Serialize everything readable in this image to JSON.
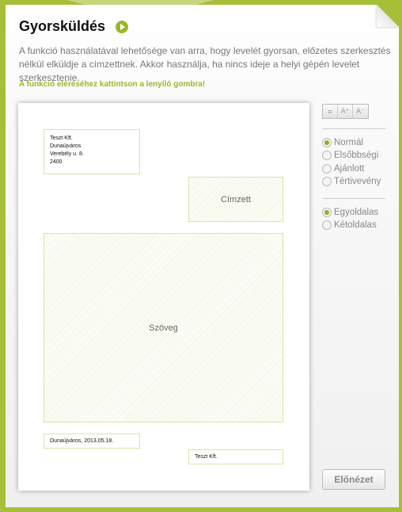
{
  "header": {
    "title": "Gyorsküldés",
    "description": "A funkció használatával lehetősége van arra, hogy levelét gyorsan, előzetes szerkesztés nélkül elküldje a címzettnek. Akkor használja, ha nincs ideje a helyi gépén levelet szerkesztenie.",
    "hint": "A funkció eléréséhez kattintson a lenyíló gombra!"
  },
  "letter": {
    "sender": [
      "Teszt Kft.",
      "Dunaújváros",
      "Verebély u. 8.",
      "2400"
    ],
    "recipient_label": "Címzett",
    "body_label": "Szöveg",
    "date": "Dunaújváros, 2013.05.18.",
    "signature": "Teszt Kft."
  },
  "toolbar": {
    "align": "≡",
    "font_up": "A⁺",
    "font_down": "A⁻"
  },
  "delivery": [
    {
      "label": "Normál",
      "selected": true
    },
    {
      "label": "Elsőbbségi",
      "selected": false
    },
    {
      "label": "Ajánlott",
      "selected": false
    },
    {
      "label": "Tértivevény",
      "selected": false
    }
  ],
  "sides": [
    {
      "label": "Egyoldalas",
      "selected": true
    },
    {
      "label": "Kétoldalas",
      "selected": false
    }
  ],
  "preview_label": "Előnézet",
  "colors": {
    "accent": "#9ab82c",
    "background": "#a6bf38"
  }
}
